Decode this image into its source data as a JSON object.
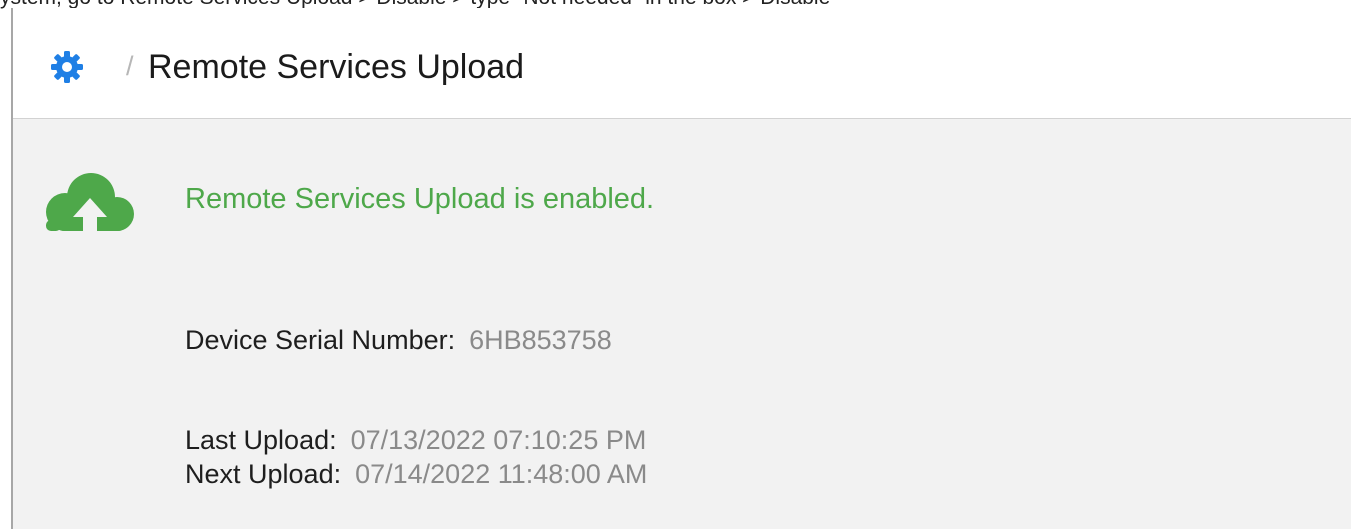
{
  "instruction": "ystem, go to Remote Services Upload > Disable > type \"Not needed\" in the box > Disable",
  "breadcrumb": {
    "separator": "/",
    "title": "Remote Services Upload"
  },
  "status": {
    "message": "Remote Services Upload is enabled.",
    "icon": "cloud-upload-icon",
    "color": "#4ea84a"
  },
  "details": {
    "serial_label": "Device Serial Number:",
    "serial_value": "6HB853758",
    "last_upload_label": "Last Upload:",
    "last_upload_value": "07/13/2022 07:10:25 PM",
    "next_upload_label": "Next Upload:",
    "next_upload_value": "07/14/2022 11:48:00 AM"
  },
  "colors": {
    "gear_icon": "#1f7fe5",
    "content_background": "#f2f2f2"
  }
}
